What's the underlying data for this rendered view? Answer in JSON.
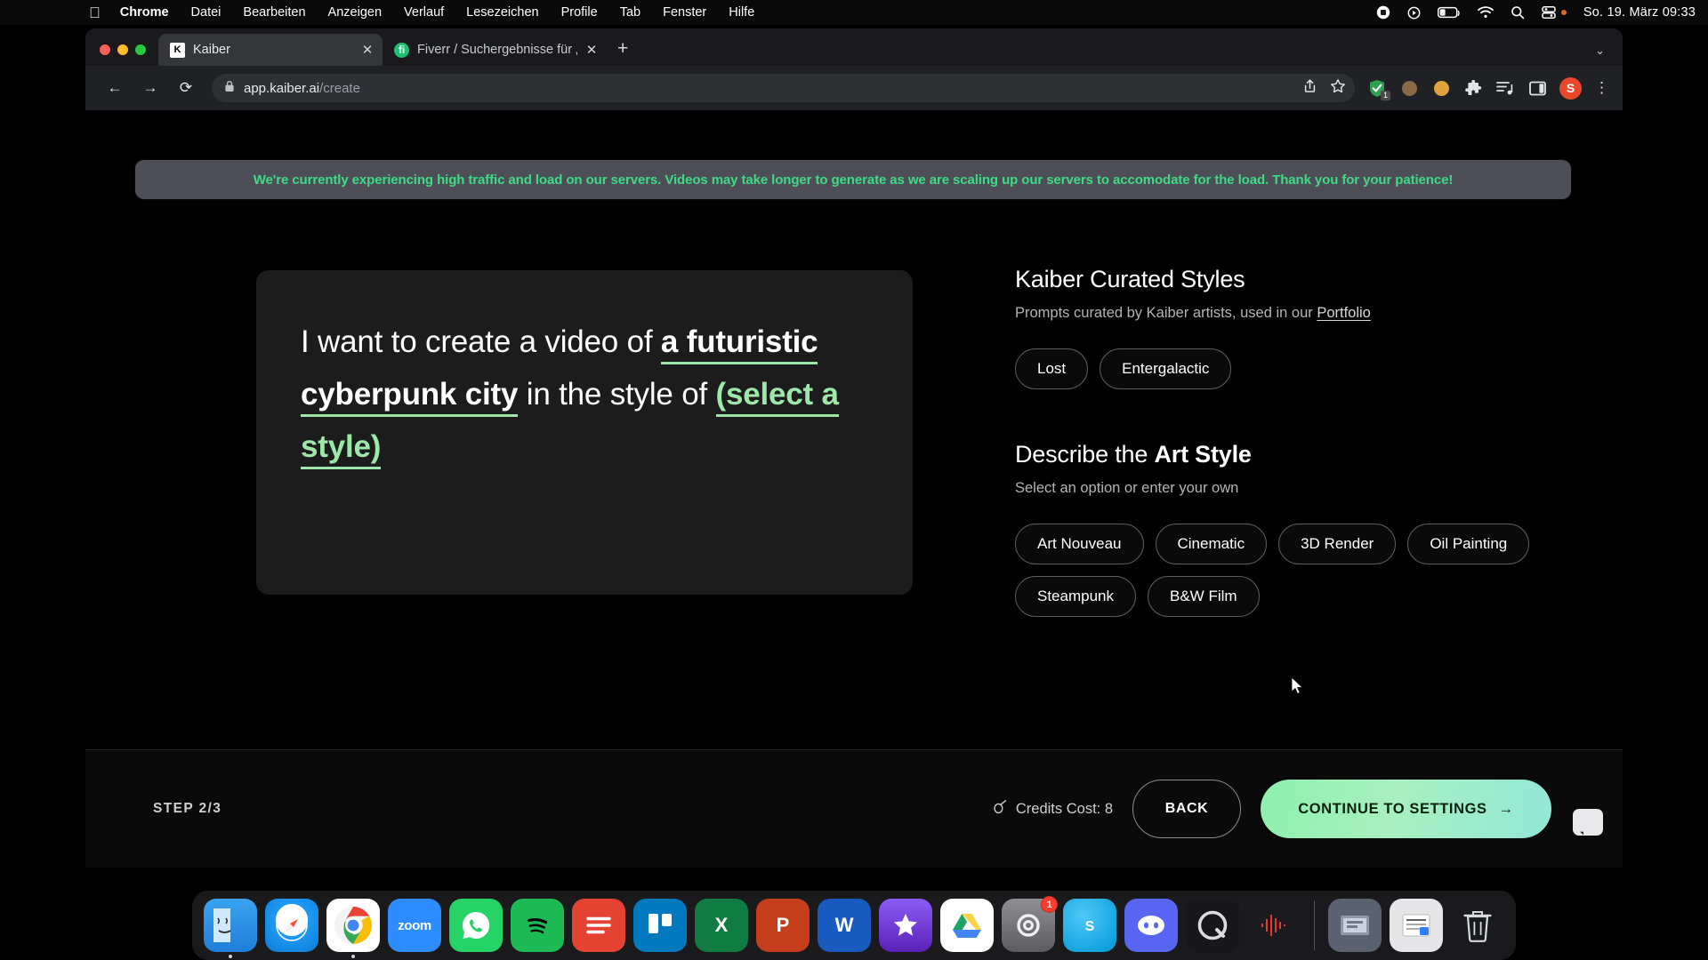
{
  "menubar": {
    "apple_icon": "apple-logo",
    "items": [
      {
        "label": "Chrome",
        "bold": true
      },
      {
        "label": "Datei",
        "bold": false
      },
      {
        "label": "Bearbeiten",
        "bold": false
      },
      {
        "label": "Anzeigen",
        "bold": false
      },
      {
        "label": "Verlauf",
        "bold": false
      },
      {
        "label": "Lesezeichen",
        "bold": false
      },
      {
        "label": "Profile",
        "bold": false
      },
      {
        "label": "Tab",
        "bold": false
      },
      {
        "label": "Fenster",
        "bold": false
      },
      {
        "label": "Hilfe",
        "bold": false
      }
    ],
    "status_icons": [
      "screen-record-icon",
      "control-center-play-icon",
      "battery-icon",
      "wifi-icon",
      "search-icon",
      "control-center-icon"
    ],
    "clock": "So. 19. März  09:33"
  },
  "browser": {
    "tabs": [
      {
        "title": "Kaiber",
        "favicon": "K",
        "favicon_name": "kaiber-favicon",
        "active": true,
        "close": "✕"
      },
      {
        "title": "Fiverr / Suchergebnisse für „lo",
        "favicon": "fi",
        "favicon_name": "fiverr-favicon",
        "active": false,
        "close": "✕"
      }
    ],
    "new_tab_label": "+",
    "tab_list_chevron": "⌄",
    "nav": {
      "back": "←",
      "forward": "→",
      "reload": "⟳"
    },
    "omnibox": {
      "lock_icon": "lock-icon",
      "url_host": "app.kaiber.ai",
      "url_path": "/create",
      "share_icon": "share-icon",
      "bookmark_icon": "star-icon"
    },
    "extensions": [
      {
        "name": "adblock-shield-icon",
        "badge": "1"
      },
      {
        "name": "cookie-dark-icon",
        "badge": ""
      },
      {
        "name": "cookie-light-icon",
        "badge": ""
      },
      {
        "name": "puzzle-extensions-icon",
        "badge": ""
      },
      {
        "name": "reading-list-icon",
        "badge": ""
      },
      {
        "name": "side-panel-icon",
        "badge": ""
      }
    ],
    "profile_avatar": "S",
    "menu_icon": "⋮"
  },
  "page": {
    "banner": "We're currently experiencing high traffic and load on our servers. Videos may take longer to generate as we are scaling up our servers to accomodate for the load. Thank you for your patience!",
    "banner_text_color": "#3ddc84",
    "banner_bg_color": "#4e4e58",
    "prompt": {
      "lead": "I want to create a video of ",
      "subject": "a futuristic cyberpunk city",
      "middle": " in the style of ",
      "style_placeholder": "(select a style)",
      "accent_color": "#9de8a8"
    },
    "curated": {
      "title": "Kaiber Curated Styles",
      "subtitle_prefix": "Prompts curated by Kaiber artists, used in our ",
      "subtitle_link": "Portfolio",
      "pills": [
        "Lost",
        "Entergalactic"
      ]
    },
    "art_style": {
      "title_prefix": "Describe the ",
      "title_bold": "Art Style",
      "subtitle": "Select an option or enter your own",
      "pills": [
        "Art Nouveau",
        "Cinematic",
        "3D Render",
        "Oil Painting",
        "Steampunk",
        "B&W Film"
      ]
    },
    "footer": {
      "step": "STEP 2/3",
      "credits_icon": "credits-icon",
      "credits_label": "Credits Cost: 8",
      "back_label": "BACK",
      "continue_label": "CONTINUE TO SETTINGS",
      "continue_arrow": "→",
      "continue_color": "#8ef0ae"
    },
    "chat_widget": "chat-bubble-icon"
  },
  "dock": {
    "items": [
      {
        "name": "finder",
        "label": "",
        "color": "#1e8fe8",
        "running": true
      },
      {
        "name": "safari",
        "label": "",
        "color": "#f5f5f7",
        "running": false
      },
      {
        "name": "chrome",
        "label": "",
        "color": "#ffffff",
        "running": true
      },
      {
        "name": "zoom",
        "label": "zoom",
        "color": "#2d8cff",
        "running": false
      },
      {
        "name": "whatsapp",
        "label": "",
        "color": "#25d366",
        "running": false
      },
      {
        "name": "spotify",
        "label": "",
        "color": "#1db954",
        "running": false
      },
      {
        "name": "todoist",
        "label": "",
        "color": "#e44332",
        "running": false
      },
      {
        "name": "trello",
        "label": "",
        "color": "#0079bf",
        "running": false
      },
      {
        "name": "excel",
        "label": "X",
        "color": "#107c41",
        "running": false
      },
      {
        "name": "powerpoint",
        "label": "P",
        "color": "#c43e1c",
        "running": false
      },
      {
        "name": "word",
        "label": "W",
        "color": "#185abd",
        "running": false
      },
      {
        "name": "star-app",
        "label": "",
        "color": "#6c3fd6",
        "running": false
      },
      {
        "name": "google-drive",
        "label": "",
        "color": "#ffffff",
        "running": false
      },
      {
        "name": "system-settings",
        "label": "",
        "color": "#8e8e93",
        "running": false,
        "badge": "1"
      },
      {
        "name": "skype",
        "label": "",
        "color": "#00aff0",
        "running": false
      },
      {
        "name": "discord",
        "label": "",
        "color": "#5865f2",
        "running": false
      },
      {
        "name": "quicktime",
        "label": "",
        "color": "#1d1d1f",
        "running": false
      },
      {
        "name": "audio-waveform",
        "label": "",
        "color": "#2a2a2e",
        "running": false
      }
    ],
    "right_items": [
      {
        "name": "downloads-stack",
        "label": "",
        "color": "#5a6470"
      },
      {
        "name": "documents-stack",
        "label": "",
        "color": "#dedede"
      },
      {
        "name": "trash",
        "label": "",
        "color": "#b9bcc2"
      }
    ]
  }
}
